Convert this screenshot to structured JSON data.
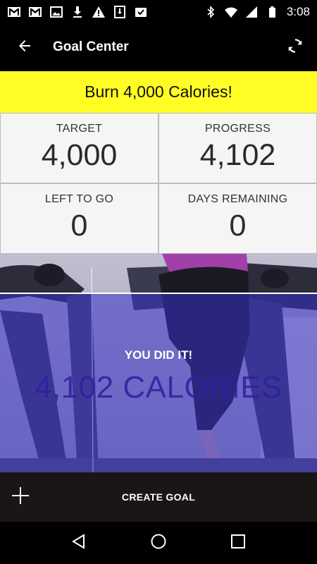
{
  "status_bar": {
    "time": "3:08",
    "icons_left": [
      "gmail-icon",
      "gmail-icon",
      "image-icon",
      "download-icon",
      "warning-icon",
      "download-box-icon",
      "inbox-check-icon"
    ],
    "icons_right": [
      "bluetooth-icon",
      "wifi-icon",
      "signal-icon",
      "battery-icon"
    ]
  },
  "app_bar": {
    "title": "Goal Center",
    "back_icon": "arrow-back-icon",
    "refresh_icon": "refresh-icon"
  },
  "goal": {
    "banner": "Burn 4,000 Calories!",
    "accent_color": "#fffd23"
  },
  "stats": {
    "target": {
      "label": "TARGET",
      "value": "4,000"
    },
    "progress": {
      "label": "PROGRESS",
      "value": "4,102"
    },
    "left_to_go": {
      "label": "LEFT TO GO",
      "value": "0"
    },
    "days_remaining": {
      "label": "DAYS REMAINING",
      "value": "0"
    }
  },
  "completion": {
    "label": "YOU DID IT!",
    "value": "4,102 CALORIES",
    "overlay_color": "#3832c8"
  },
  "action_bar": {
    "create_label": "CREATE GOAL",
    "add_icon": "plus-icon"
  },
  "nav_bar": {
    "icons": [
      "back-triangle-icon",
      "home-circle-icon",
      "recents-square-icon"
    ]
  }
}
